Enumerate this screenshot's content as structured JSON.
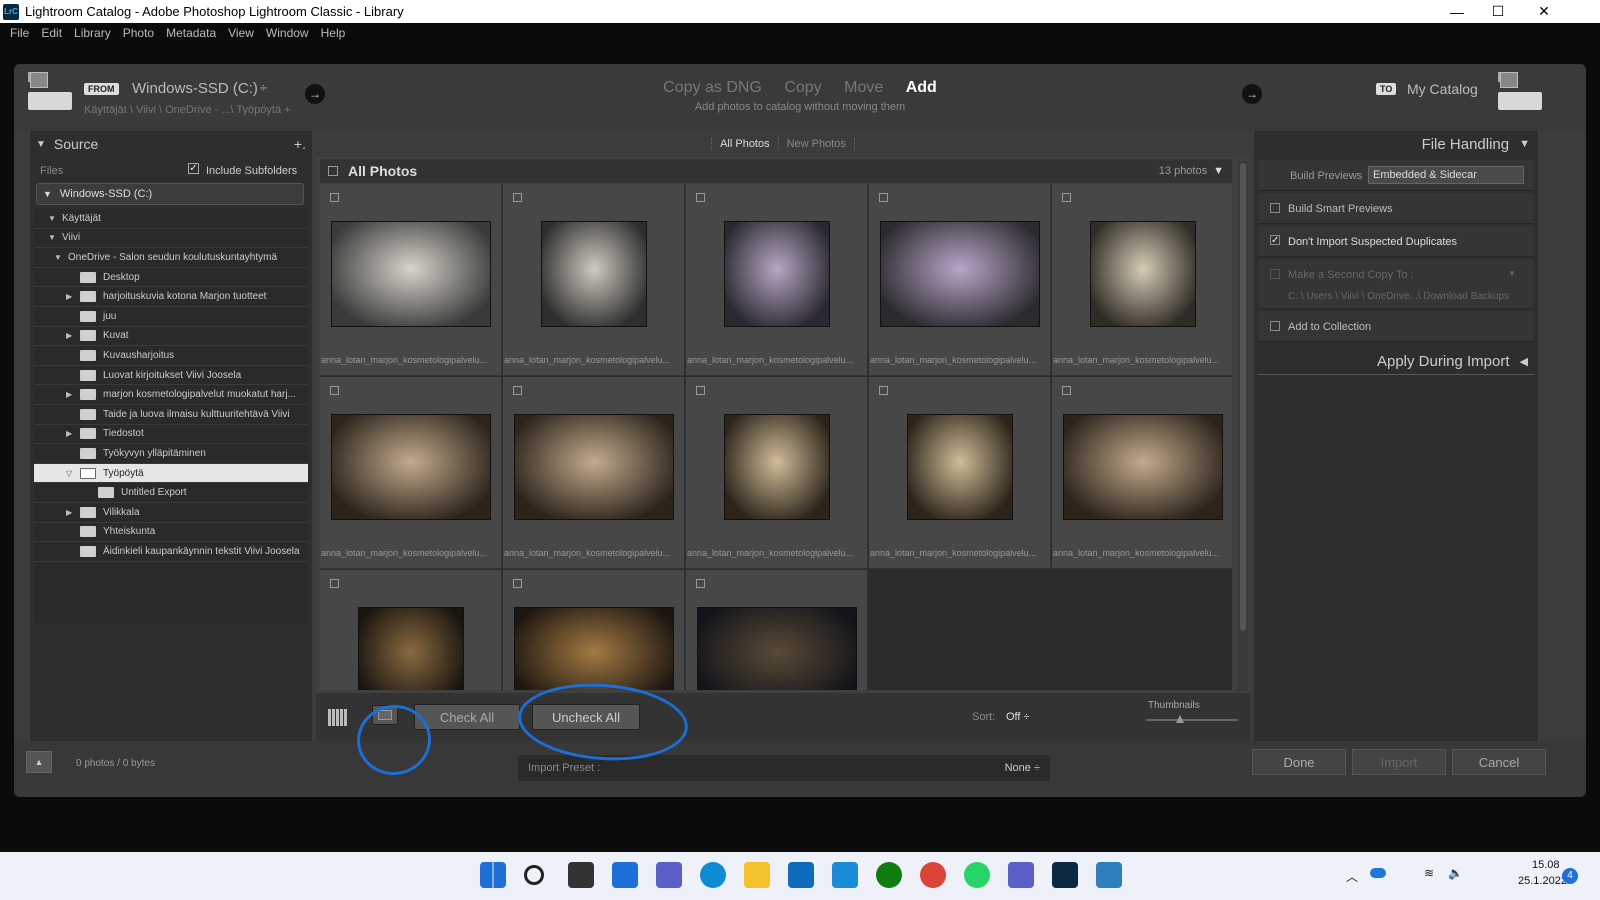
{
  "window": {
    "title": "Lightroom Catalog - Adobe Photoshop Lightroom Classic - Library",
    "app_badge": "LrC",
    "minimize": "—",
    "maximize": "☐",
    "close": "✕"
  },
  "menu": [
    "File",
    "Edit",
    "Library",
    "Photo",
    "Metadata",
    "View",
    "Window",
    "Help"
  ],
  "header": {
    "from_badge": "FROM",
    "source_drive": "Windows-SSD (C:)",
    "source_drive_arrow": "÷",
    "source_path": "Käyttäjät \\ Viivi \\ OneDrive - ...\\ Työpöytä +",
    "modes": [
      "Copy as DNG",
      "Copy",
      "Move",
      "Add"
    ],
    "active_mode": "Add",
    "mode_description": "Add photos to catalog without moving them",
    "to_badge": "TO",
    "destination": "My Catalog"
  },
  "source_panel": {
    "title": "Source",
    "add_icon": "+.",
    "files_label": "Files",
    "include_subfolders": "Include Subfolders",
    "include_subfolders_checked": true,
    "drive": "Windows-SSD (C:)",
    "tree": [
      {
        "label": "Käyttäjät",
        "level": 0,
        "expanded": true,
        "folder": false
      },
      {
        "label": "Viivi",
        "level": 0,
        "expanded": true,
        "folder": false
      },
      {
        "label": "OneDrive - Salon seudun koulutuskuntayhtymä",
        "level": 1,
        "expanded": true,
        "folder": false
      },
      {
        "label": "Desktop",
        "level": 2,
        "folder": true
      },
      {
        "label": "harjoituskuvia kotona Marjon tuotteet",
        "level": 2,
        "folder": true,
        "collapsed": true
      },
      {
        "label": "juu",
        "level": 2,
        "folder": true
      },
      {
        "label": "Kuvat",
        "level": 2,
        "folder": true,
        "collapsed": true
      },
      {
        "label": "Kuvausharjoitus",
        "level": 2,
        "folder": true
      },
      {
        "label": "Luovat kirjoitukset Viivi Joosela",
        "level": 2,
        "folder": true
      },
      {
        "label": "marjon kosmetologipalvelut muokatut harj...",
        "level": 2,
        "folder": true,
        "collapsed": true
      },
      {
        "label": "Taide ja luova ilmaisu kulttuuritehtävä Viivi",
        "level": 2,
        "folder": true
      },
      {
        "label": "Tiedostot",
        "level": 2,
        "folder": true,
        "collapsed": true
      },
      {
        "label": "Työkyvyn ylläpitäminen",
        "level": 2,
        "folder": true
      },
      {
        "label": "Työpöytä",
        "level": 2,
        "folder": true,
        "expanded": true,
        "selected": true
      },
      {
        "label": "Untitled Export",
        "level": 3,
        "folder": true
      },
      {
        "label": "Vilikkala",
        "level": 2,
        "folder": true,
        "collapsed": true
      },
      {
        "label": "Yhteiskunta",
        "level": 2,
        "folder": true
      },
      {
        "label": "Äidinkieli kaupankäynnin tekstit Viivi Joosela",
        "level": 2,
        "folder": true
      }
    ]
  },
  "center": {
    "tabs": [
      "All Photos",
      "New Photos"
    ],
    "active_tab": "All Photos",
    "grid_title": "All Photos",
    "photo_count": "13 photos",
    "photos": [
      {
        "name": "anna_lotan_marjon_kosmetologipalvelu...",
        "tone": "cool"
      },
      {
        "name": "anna_lotan_marjon_kosmetologipalvelu...",
        "tone": "cool-small"
      },
      {
        "name": "anna_lotan_marjon_kosmetologipalvelu...",
        "tone": "purple-small"
      },
      {
        "name": "anna_lotan_marjon_kosmetologipalvelu...",
        "tone": "purple"
      },
      {
        "name": "anna_lotan_marjon_kosmetologipalvelu...",
        "tone": "warm-small"
      },
      {
        "name": "anna_lotan_marjon_kosmetologipalvelu...",
        "tone": "sepia"
      },
      {
        "name": "anna_lotan_marjon_kosmetologipalvelu...",
        "tone": "sepia"
      },
      {
        "name": "anna_lotan_marjon_kosmetologipalvelu...",
        "tone": "sepia-small"
      },
      {
        "name": "anna_lotan_marjon_kosmetologipalvelu...",
        "tone": "sepia-small"
      },
      {
        "name": "anna_lotan_marjon_kosmetologipalvelu...",
        "tone": "sepia"
      },
      {
        "name": "",
        "tone": "lamp-small"
      },
      {
        "name": "",
        "tone": "lamp"
      },
      {
        "name": "",
        "tone": "lamp-dark"
      }
    ],
    "toolbar": {
      "check_all": "Check All",
      "uncheck_all": "Uncheck All",
      "sort_label": "Sort:",
      "sort_value": "Off ÷",
      "thumbnails_label": "Thumbnails"
    }
  },
  "file_handling": {
    "title": "File Handling",
    "build_previews_label": "Build Previews",
    "build_previews_value": "Embedded & Sidecar",
    "smart_previews": "Build Smart Previews",
    "smart_previews_checked": false,
    "dont_import_duplicates": "Don't Import Suspected Duplicates",
    "dont_import_duplicates_checked": true,
    "second_copy": "Make a Second Copy To :",
    "second_copy_path": "C: \\ Users \\ Viivi \\ OneDrive...\\ Download Backups",
    "add_to_collection": "Add to Collection",
    "apply_during_import": "Apply During Import"
  },
  "bottom": {
    "status": "0 photos / 0 bytes",
    "import_preset_label": "Import Preset :",
    "import_preset_value": "None ÷",
    "done": "Done",
    "import": "Import",
    "cancel": "Cancel"
  },
  "taskbar": {
    "time": "15.08",
    "date": "25.1.2022",
    "notifications": "4"
  },
  "colors": {
    "annotation": "#1a6fd8",
    "panel": "#2e2e2e",
    "grid": "#474747"
  }
}
